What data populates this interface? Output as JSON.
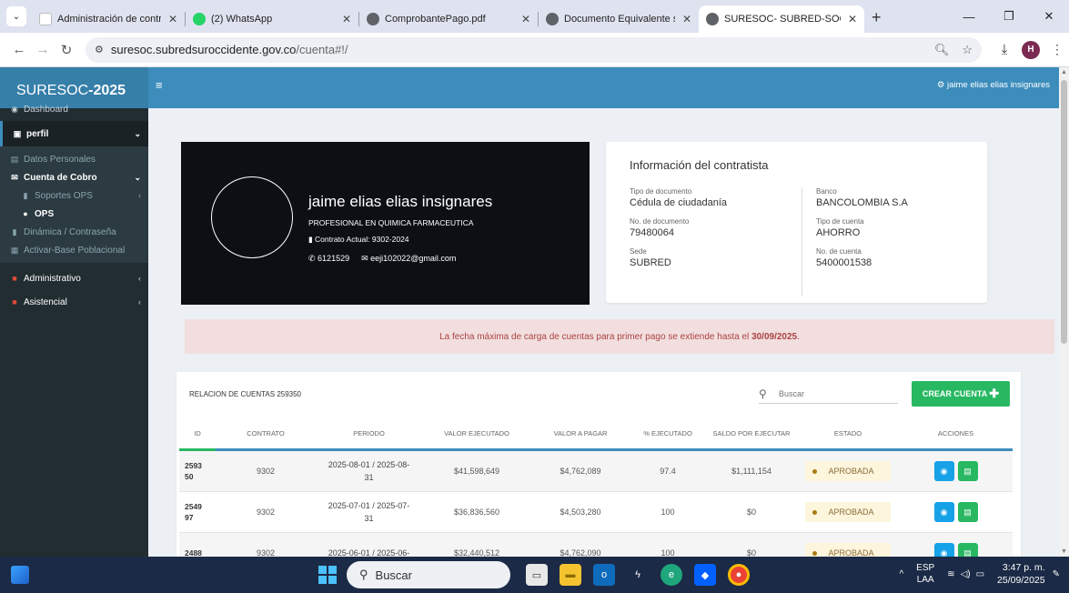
{
  "browser": {
    "tabs": [
      {
        "title": "Administración de contratos",
        "favicon_color": "#ffffff",
        "active": false
      },
      {
        "title": "(2) WhatsApp",
        "favicon_color": "#25d366",
        "active": false
      },
      {
        "title": "ComprobantePago.pdf",
        "favicon_color": "#5f6368",
        "active": false
      },
      {
        "title": "Documento Equivalente sep",
        "favicon_color": "#5f6368",
        "active": false
      },
      {
        "title": "SURESOC- SUBRED-SOC",
        "favicon_color": "#5f6368",
        "active": true
      }
    ],
    "url_host": "suresoc.subredsuroccidente.gov.co",
    "url_path": "/cuenta#!/",
    "profile_initial": "H"
  },
  "app": {
    "brand_main": "SURESOC",
    "brand_year": "-2025",
    "top_user": "jaime elias elias insignares"
  },
  "sidebar": {
    "dashboard": "Dashboard",
    "perfil": "perfil",
    "datos_personales": "Datos Personales",
    "cuenta_de_cobro": "Cuenta de Cobro",
    "soportes_ops": "Soportes OPS",
    "ops": "OPS",
    "dinamica": "Dinámica / Contraseña",
    "activar_base": "Activar-Base Poblacional",
    "administrativo": "Administrativo",
    "asistencial": "Asistencial"
  },
  "profile": {
    "name": "jaime elias elias insignares",
    "role": "PROFESIONAL EN QUIMICA FARMACEUTICA",
    "contract": "Contrato Actual: 9302-2024",
    "phone": "6121529",
    "email": "eeji102022@gmail.com"
  },
  "info": {
    "title": "Información del contratista",
    "tipo_doc_label": "Tipo de documento",
    "tipo_doc": "Cédula de ciudadanía",
    "num_doc_label": "No. de documento",
    "num_doc": "79480064",
    "sede_label": "Sede",
    "sede": "SUBRED",
    "banco_label": "Banco",
    "banco": "BANCOLOMBIA S.A",
    "tipo_cuenta_label": "Tipo de cuenta",
    "tipo_cuenta": "AHORRO",
    "num_cuenta_label": "No. de cuenta",
    "num_cuenta": "5400001538"
  },
  "alert": {
    "text": "La fecha máxima de carga de cuentas para primer pago se extiende hasta el ",
    "date": "30/09/2025",
    "end": "."
  },
  "table": {
    "title": "RELACION DE CUENTAS 259350",
    "search_placeholder": "Buscar",
    "create_button": "CREAR CUENTA",
    "headers": [
      "ID",
      "CONTRATO",
      "PERIODO",
      "VALOR EJECUTADO",
      "VALOR A PAGAR",
      "% EJECUTADO",
      "SALDO POR EJECUTAR",
      "ESTADO",
      "ACCIONES"
    ],
    "rows": [
      {
        "id1": "2593",
        "id2": "50",
        "contrato": "9302",
        "periodo1": "2025-08-01 / 2025-08-",
        "periodo2": "31",
        "valor_ejecutado": "$41,598,649",
        "valor_pagar": "$4,762,089",
        "pct": "97.4",
        "saldo": "$1,111,154",
        "estado": "APROBADA"
      },
      {
        "id1": "2549",
        "id2": "97",
        "contrato": "9302",
        "periodo1": "2025-07-01 / 2025-07-",
        "periodo2": "31",
        "valor_ejecutado": "$36,836,560",
        "valor_pagar": "$4,503,280",
        "pct": "100",
        "saldo": "$0",
        "estado": "APROBADA"
      },
      {
        "id1": "2488",
        "id2": "",
        "contrato": "9302",
        "periodo1": "2025-06-01 / 2025-06-",
        "periodo2": "",
        "valor_ejecutado": "$32,440,512",
        "valor_pagar": "$4,762,090",
        "pct": "100",
        "saldo": "$0",
        "estado": "APROBADA"
      }
    ]
  },
  "taskbar": {
    "search": "Buscar",
    "lang1": "ESP",
    "lang2": "LAA",
    "time": "3:47 p. m.",
    "date": "25/09/2025"
  }
}
